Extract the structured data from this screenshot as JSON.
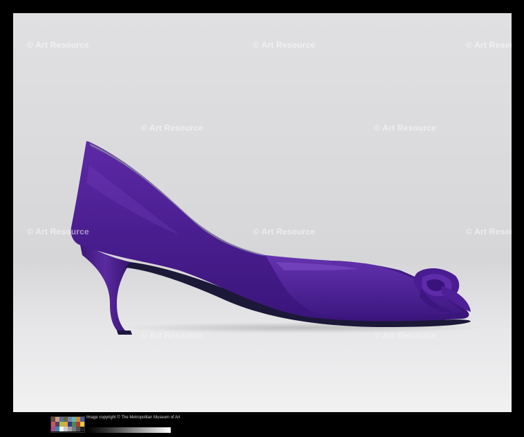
{
  "watermark": {
    "text": "© Art Resource"
  },
  "caption": {
    "copyright": "Image copyright © The Metropolitan Museum of Art"
  },
  "colors": {
    "shoe": "#4a1e8c",
    "shoe_highlight": "#6a3ab8",
    "shoe_shadow": "#2a0f58",
    "sole": "#1a1a3a",
    "background": "#dcdcde",
    "frame": "#000000"
  },
  "calibration": {
    "color_chart_swatches": [
      "#6b4a3a",
      "#c89a82",
      "#5b6f93",
      "#5a6a3c",
      "#8083b2",
      "#62b9ac",
      "#d98a2f",
      "#4a5aa0",
      "#c25a5e",
      "#5a3a6a",
      "#a9c04a",
      "#e0a83a",
      "#2a3a8a",
      "#4a8a4a",
      "#b03a3a",
      "#e6c83a",
      "#b04a8a",
      "#3a8aaa",
      "#f2f2f2",
      "#c8c8c8",
      "#a0a0a0",
      "#787878",
      "#505050",
      "#1e1e1e"
    ]
  }
}
